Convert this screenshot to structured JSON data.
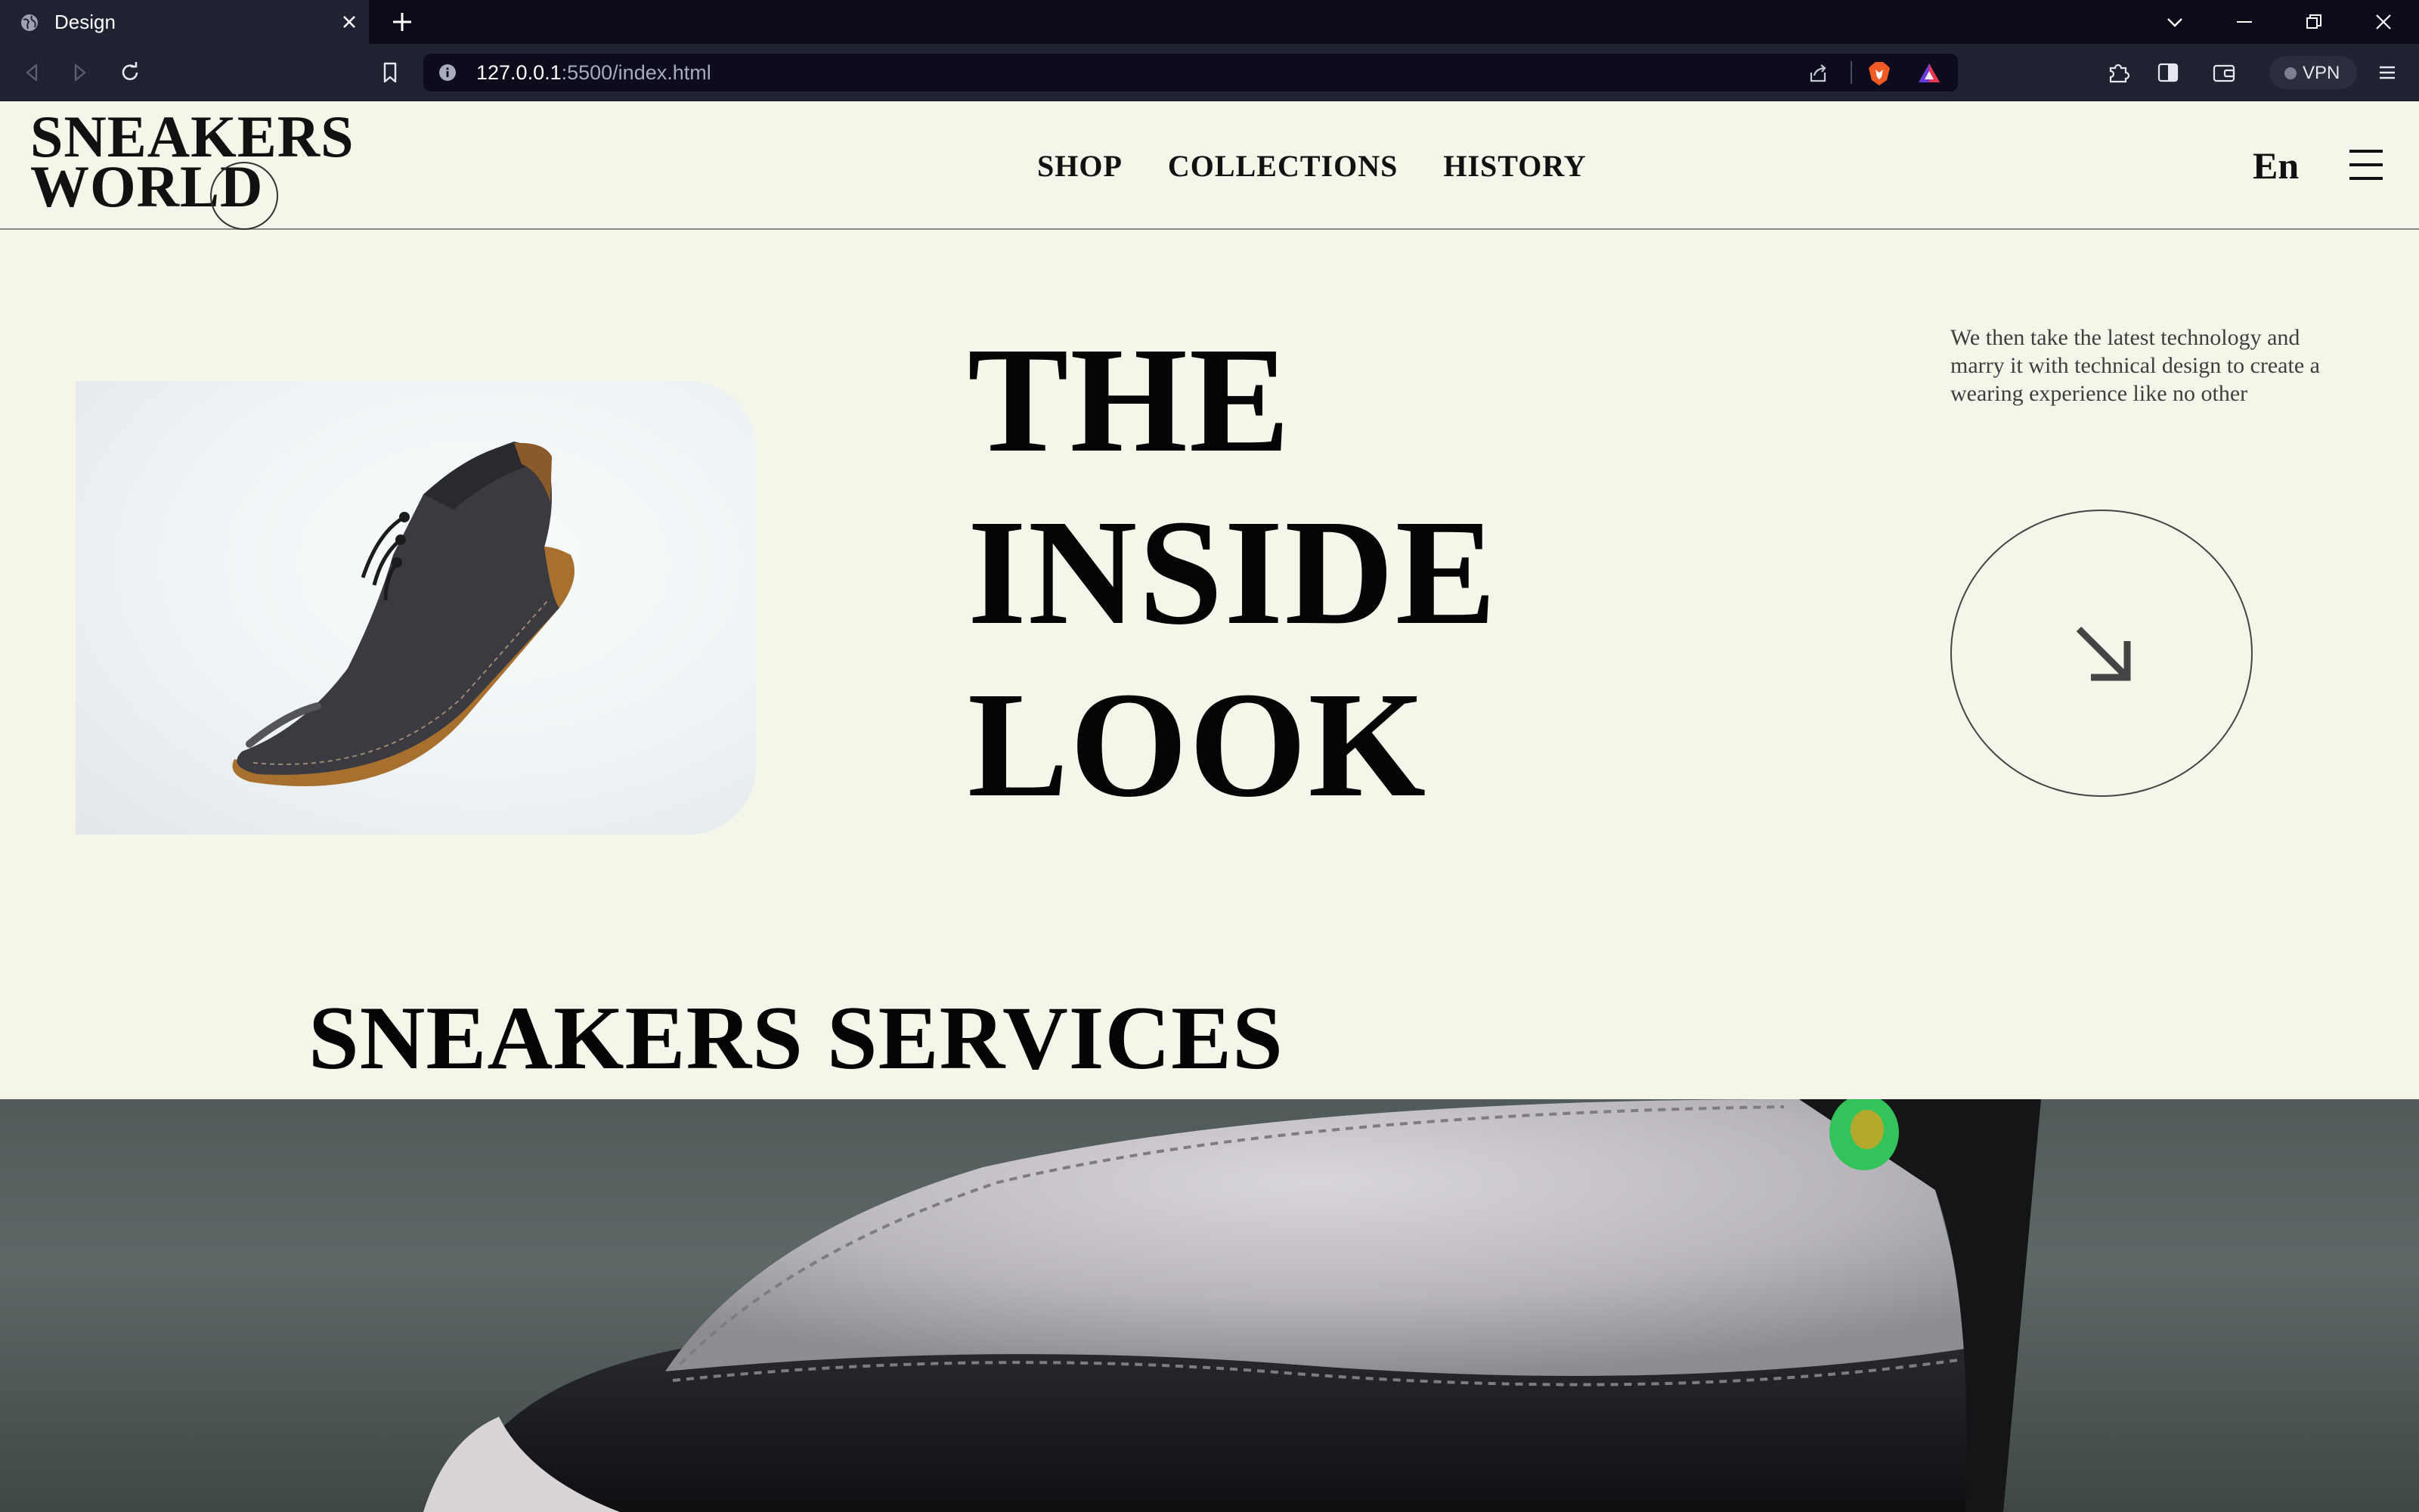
{
  "browser": {
    "tab_title": "Design",
    "url_host": "127.0.0.1",
    "url_path": ":5500/index.html",
    "vpn_label": "VPN"
  },
  "site": {
    "logo_line1": "SNEAKERS",
    "logo_line2": "WORLD",
    "nav": [
      "SHOP",
      "COLLECTIONS",
      "HISTORY"
    ],
    "language": "En"
  },
  "hero": {
    "title_lines": [
      "THE",
      "INSIDE",
      "LOOK"
    ],
    "copy": "We then take the latest technology and marry it with technical design to create a wearing experience like no other"
  },
  "services": {
    "title": "SNEAKERS SERVICES"
  },
  "colors": {
    "page_bg": "#f5f5ea",
    "text": "#050505",
    "browser_frame": "#202232"
  }
}
